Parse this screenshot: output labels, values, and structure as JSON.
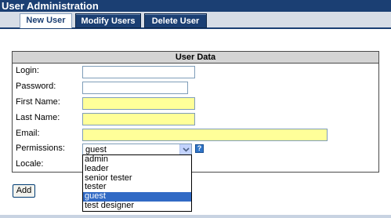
{
  "window": {
    "title": "User Administration"
  },
  "tabs": [
    {
      "label": "New User",
      "active": true
    },
    {
      "label": "Modify Users",
      "active": false
    },
    {
      "label": "Delete User",
      "active": false
    }
  ],
  "form": {
    "section_title": "User Data",
    "fields": {
      "login": {
        "label": "Login:",
        "value": "",
        "required": false
      },
      "password": {
        "label": "Password:",
        "value": "",
        "required": false
      },
      "first_name": {
        "label": "First Name:",
        "value": "",
        "required": true
      },
      "last_name": {
        "label": "Last Name:",
        "value": "",
        "required": true
      },
      "email": {
        "label": "Email:",
        "value": "",
        "required": true
      },
      "permissions": {
        "label": "Permissions:",
        "selected": "guest"
      },
      "locale": {
        "label": "Locale:"
      }
    },
    "help_icon": {
      "icon": "help-icon",
      "glyph": "?"
    },
    "permission_options": [
      "admin",
      "leader",
      "senior tester",
      "tester",
      "guest",
      "test designer"
    ],
    "add_button": "Add"
  },
  "colors": {
    "header_blue": "#1b3f73",
    "required_field": "#ffff99",
    "selection": "#316ac5"
  }
}
